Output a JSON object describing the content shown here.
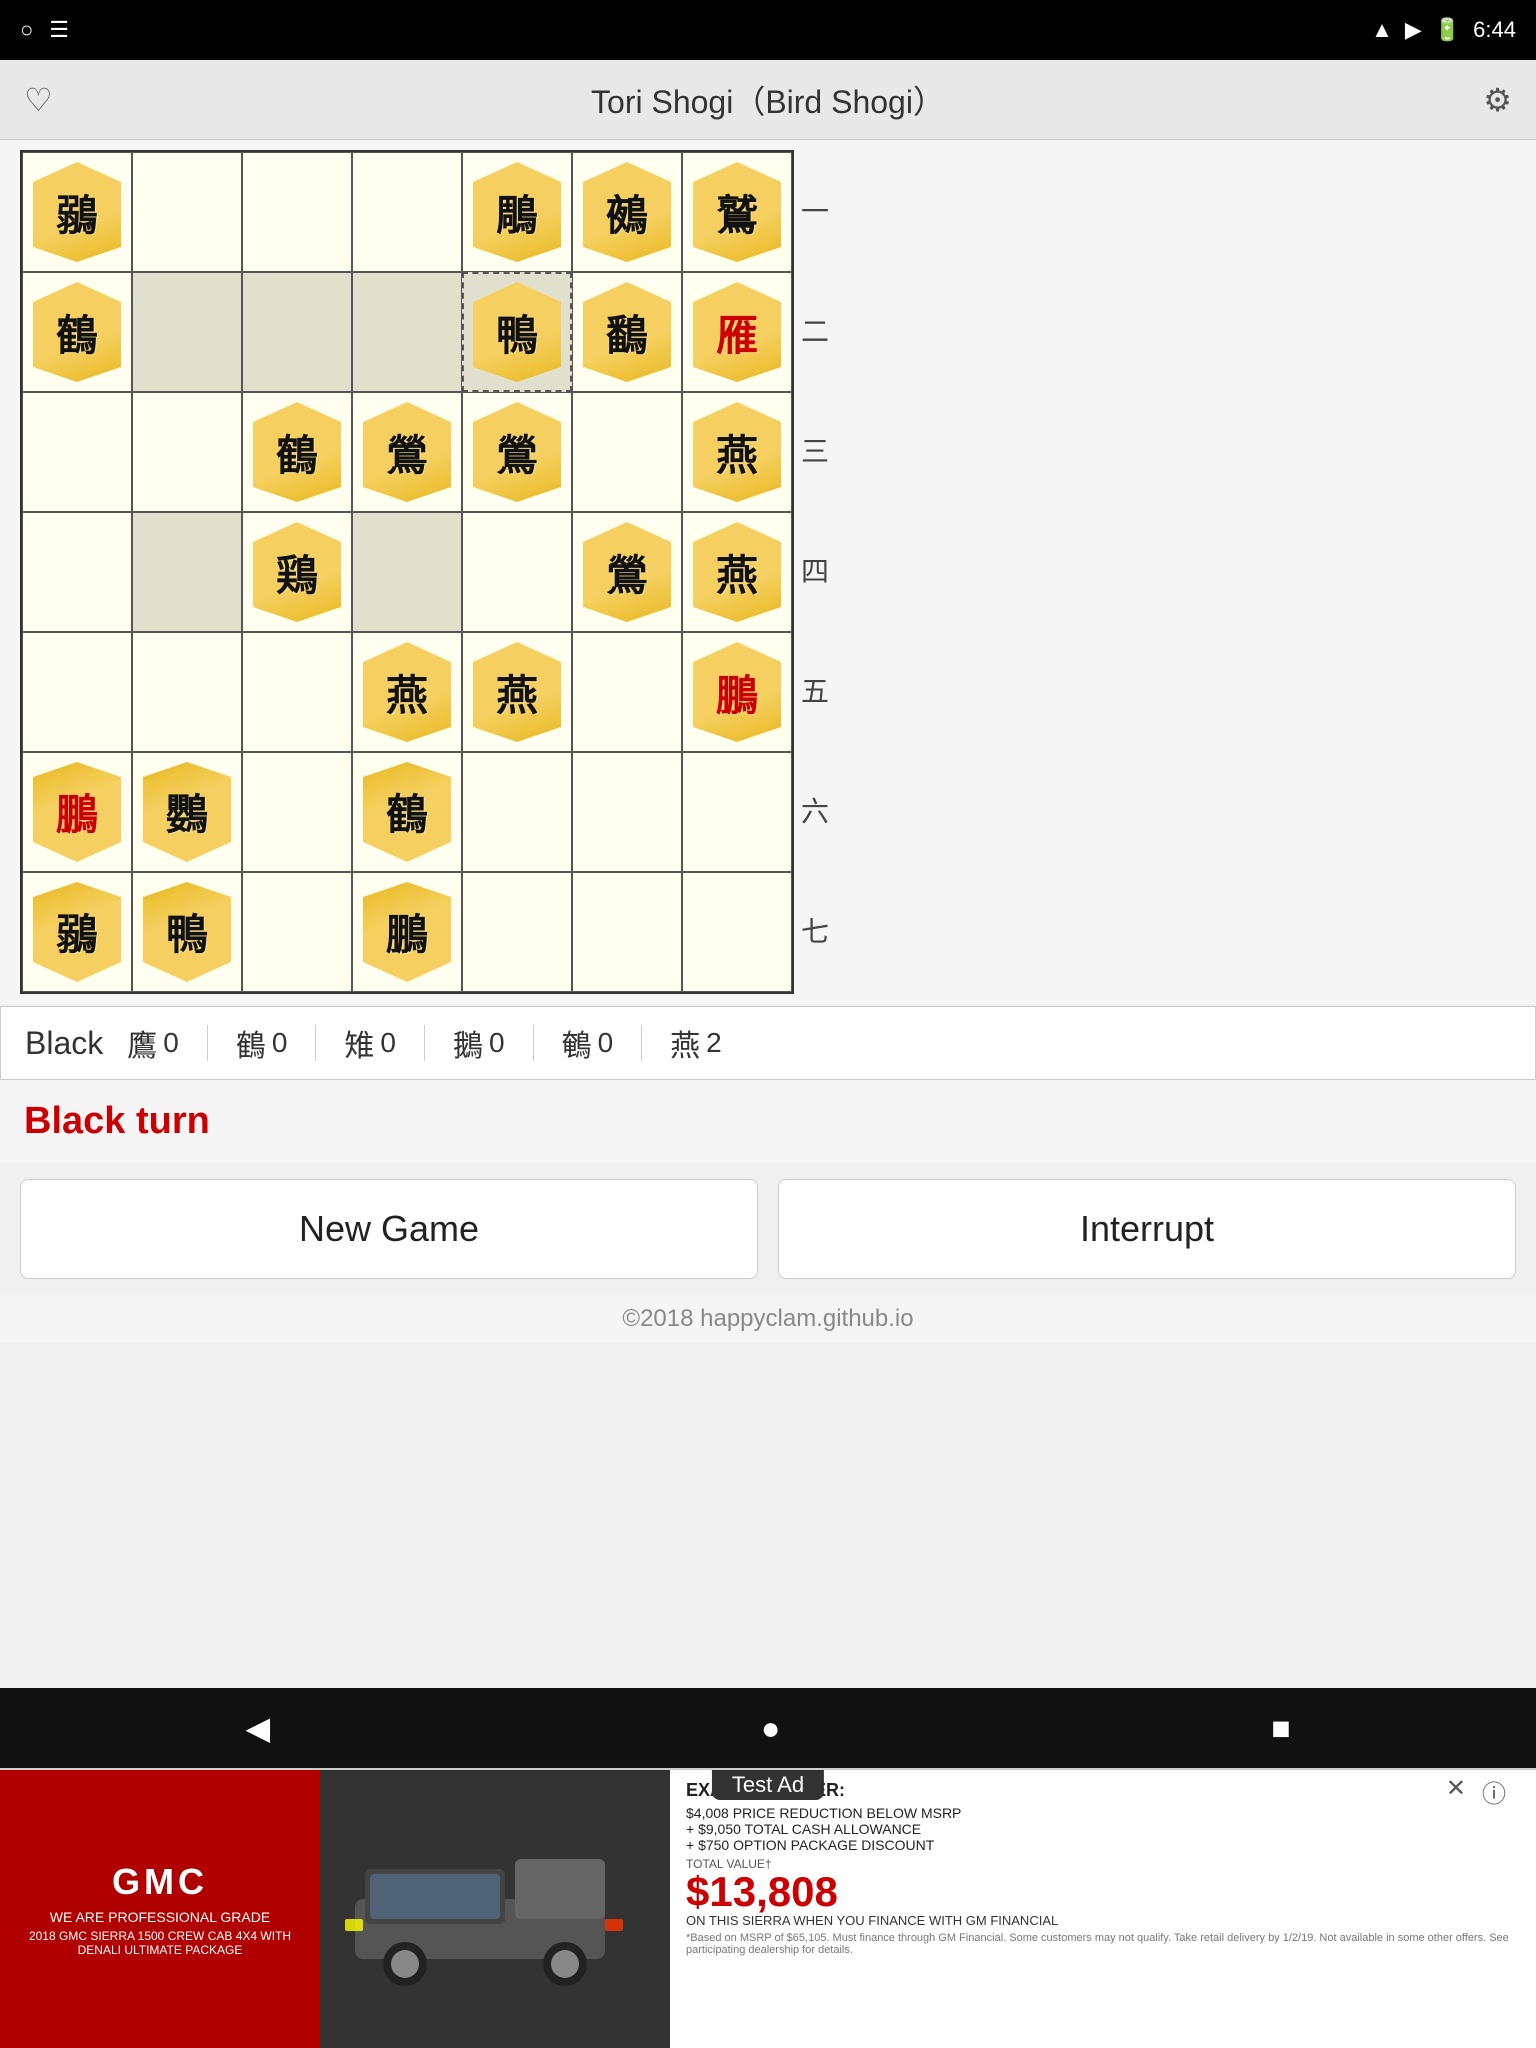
{
  "statusBar": {
    "leftIcons": [
      "○",
      "☰"
    ],
    "time": "6:44",
    "rightIcons": [
      "▲",
      "▶",
      "🔋"
    ]
  },
  "header": {
    "title": "Tori Shogi（Bird Shogi）",
    "leftIcon": "♡",
    "rightIcon": "⚙"
  },
  "board": {
    "rowLabels": [
      "一",
      "二",
      "三",
      "四",
      "五",
      "六",
      "七"
    ],
    "rows": [
      [
        {
          "piece": "鶸",
          "type": "gold",
          "empty": false
        },
        {
          "piece": "",
          "type": "empty",
          "empty": true
        },
        {
          "piece": "",
          "type": "empty",
          "empty": true
        },
        {
          "piece": "",
          "type": "empty",
          "empty": true
        },
        {
          "piece": "鵰",
          "type": "gold",
          "empty": false
        },
        {
          "piece": "鵺",
          "type": "gold",
          "empty": false
        },
        {
          "piece": "鷲",
          "type": "gold",
          "empty": false
        }
      ],
      [
        {
          "piece": "鶴",
          "type": "gold",
          "empty": false
        },
        {
          "piece": "",
          "type": "highlight",
          "empty": true
        },
        {
          "piece": "",
          "type": "highlight",
          "empty": true
        },
        {
          "piece": "",
          "type": "highlight",
          "empty": true
        },
        {
          "piece": "鴨",
          "type": "gold-selected",
          "empty": false
        },
        {
          "piece": "鷭",
          "type": "gold",
          "empty": false
        },
        {
          "piece": "雁",
          "type": "gold-red",
          "empty": false
        }
      ],
      [
        {
          "piece": "",
          "type": "empty",
          "empty": true
        },
        {
          "piece": "",
          "type": "empty",
          "empty": true
        },
        {
          "piece": "鶴",
          "type": "gold",
          "empty": false
        },
        {
          "piece": "鶯",
          "type": "gold",
          "empty": false
        },
        {
          "piece": "鶯",
          "type": "gold",
          "empty": false
        },
        {
          "piece": "",
          "type": "empty",
          "empty": true
        },
        {
          "piece": "燕",
          "type": "gold",
          "empty": false
        }
      ],
      [
        {
          "piece": "",
          "type": "empty",
          "empty": true
        },
        {
          "piece": "",
          "type": "highlight",
          "empty": true
        },
        {
          "piece": "鶏",
          "type": "gold",
          "empty": false
        },
        {
          "piece": "",
          "type": "highlight",
          "empty": true
        },
        {
          "piece": "",
          "type": "empty",
          "empty": true
        },
        {
          "piece": "鶯",
          "type": "gold",
          "empty": false
        },
        {
          "piece": "燕",
          "type": "gold",
          "empty": false
        }
      ],
      [
        {
          "piece": "",
          "type": "empty",
          "empty": true
        },
        {
          "piece": "",
          "type": "empty",
          "empty": true
        },
        {
          "piece": "",
          "type": "empty",
          "empty": true
        },
        {
          "piece": "燕",
          "type": "gold",
          "empty": false
        },
        {
          "piece": "燕",
          "type": "gold",
          "empty": false
        },
        {
          "piece": "",
          "type": "empty",
          "empty": true
        },
        {
          "piece": "鵬",
          "type": "gold-red",
          "empty": false
        }
      ],
      [
        {
          "piece": "鵬",
          "type": "gold-red-inv",
          "empty": false
        },
        {
          "piece": "鸚",
          "type": "gold-inv",
          "empty": false
        },
        {
          "piece": "",
          "type": "empty",
          "empty": true
        },
        {
          "piece": "鶴",
          "type": "gold-inv",
          "empty": false
        },
        {
          "piece": "",
          "type": "empty",
          "empty": true
        },
        {
          "piece": "",
          "type": "empty",
          "empty": true
        },
        {
          "piece": "",
          "type": "empty",
          "empty": true
        }
      ],
      [
        {
          "piece": "鶸",
          "type": "gold-inv",
          "empty": false
        },
        {
          "piece": "鴨",
          "type": "gold-inv",
          "empty": false
        },
        {
          "piece": "",
          "type": "empty",
          "empty": true
        },
        {
          "piece": "鵬",
          "type": "gold-inv",
          "empty": false
        },
        {
          "piece": "",
          "type": "empty",
          "empty": true
        },
        {
          "piece": "",
          "type": "empty",
          "empty": true
        },
        {
          "piece": "",
          "type": "empty",
          "empty": true
        }
      ]
    ]
  },
  "blackInfo": {
    "label": "Black",
    "counts": [
      {
        "piece": "鷹",
        "count": "0"
      },
      {
        "piece": "鶴",
        "count": "0"
      },
      {
        "piece": "雉",
        "count": "0"
      },
      {
        "piece": "鵝",
        "count": "0"
      },
      {
        "piece": "鵪",
        "count": "0"
      },
      {
        "piece": "燕",
        "count": "2"
      }
    ]
  },
  "turnIndicator": "Black turn",
  "buttons": {
    "newGame": "New Game",
    "interrupt": "Interrupt"
  },
  "copyright": "©2018 happyclam.github.io",
  "ad": {
    "testLabel": "Test Ad",
    "brand": "GMC",
    "tagline": "WE ARE PROFESSIONAL GRADE",
    "model": "2018 GMC SIERRA 1500 CREW CAB 4X4\nWITH DENALI ULTIMATE PACKAGE",
    "offerTitle": "EXAMPLE OFFER:",
    "bullet1": "$4,008 PRICE REDUCTION BELOW MSRP",
    "bullet2": "+ $9,050 TOTAL CASH ALLOWANCE",
    "bullet3": "+ $750 OPTION PACKAGE DISCOUNT",
    "totalValue": "TOTAL VALUE†",
    "price": "$13,808",
    "priceNote": "ON THIS SIERRA\nWHEN YOU FINANCE\nWITH GM FINANCIAL",
    "disclaimer": "*Based on MSRP of $65,105. Must finance through GM Financial. Some customers may not qualify. Take retail delivery by 1/2/19. Not available in some other offers. See participating dealership for details."
  },
  "navBar": {
    "back": "◀",
    "home": "●",
    "square": "■"
  }
}
